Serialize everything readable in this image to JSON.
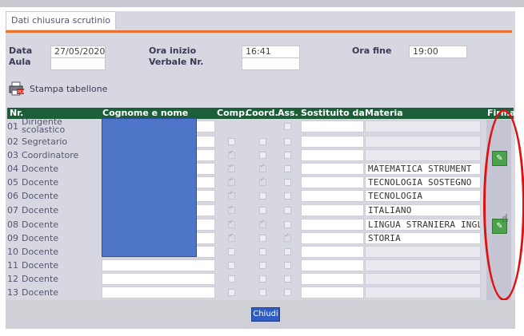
{
  "tab": "Dati chiusura scrutinio",
  "header": {
    "data_label": "Data",
    "data_value": "27/05/2020",
    "aula_label": "Aula",
    "aula_value": "",
    "ora_inizio_label": "Ora inizio",
    "ora_inizio_value": "16:41",
    "verbale_label": "Verbale Nr.",
    "verbale_value": "",
    "ora_fine_label": "Ora fine",
    "ora_fine_value": "19:00"
  },
  "print_label": "Stampa tabellone",
  "columns": {
    "nr": "Nr.",
    "nome": "Cognome e nome",
    "comp": "Comp.",
    "coord": "Coord.",
    "ass": "Ass.",
    "sost": "Sostituito da",
    "materia": "Materia",
    "firma": "Firma"
  },
  "rows": [
    {
      "nr": "01",
      "role": "Dirigente scolastico",
      "comp": null,
      "coord": null,
      "ass": false,
      "materia": ""
    },
    {
      "nr": "02",
      "role": "Segretario",
      "comp": false,
      "coord": false,
      "ass": false,
      "materia": ""
    },
    {
      "nr": "03",
      "role": "Coordinatore",
      "comp": true,
      "coord": false,
      "ass": false,
      "materia": ""
    },
    {
      "nr": "04",
      "role": "Docente",
      "comp": true,
      "coord": true,
      "ass": false,
      "materia": "MATEMATICA STRUMENT"
    },
    {
      "nr": "05",
      "role": "Docente",
      "comp": true,
      "coord": true,
      "ass": false,
      "materia": "TECNOLOGIA SOSTEGNO"
    },
    {
      "nr": "06",
      "role": "Docente",
      "comp": true,
      "coord": false,
      "ass": false,
      "materia": "TECNOLOGIA"
    },
    {
      "nr": "07",
      "role": "Docente",
      "comp": true,
      "coord": false,
      "ass": false,
      "materia": "ITALIANO"
    },
    {
      "nr": "08",
      "role": "Docente",
      "comp": true,
      "coord": true,
      "ass": false,
      "materia": "LINGUA STRANIERA INGL"
    },
    {
      "nr": "09",
      "role": "Docente",
      "comp": true,
      "coord": false,
      "ass": true,
      "materia": "STORIA"
    },
    {
      "nr": "10",
      "role": "Docente",
      "comp": false,
      "coord": false,
      "ass": false,
      "materia": ""
    },
    {
      "nr": "11",
      "role": "Docente",
      "comp": false,
      "coord": false,
      "ass": false,
      "materia": ""
    },
    {
      "nr": "12",
      "role": "Docente",
      "comp": false,
      "coord": false,
      "ass": false,
      "materia": ""
    },
    {
      "nr": "13",
      "role": "Docente",
      "comp": false,
      "coord": false,
      "ass": false,
      "materia": ""
    }
  ],
  "close_label": "Chiudi",
  "icons": {
    "print": "printer-icon",
    "firma": "sign-icon"
  },
  "colors": {
    "accent": "#e8722e",
    "header": "#1b5e37",
    "button": "#2e5cc0",
    "sign": "#4aa34a",
    "redaction": "#4f75c9",
    "annotation": "#e01010"
  }
}
